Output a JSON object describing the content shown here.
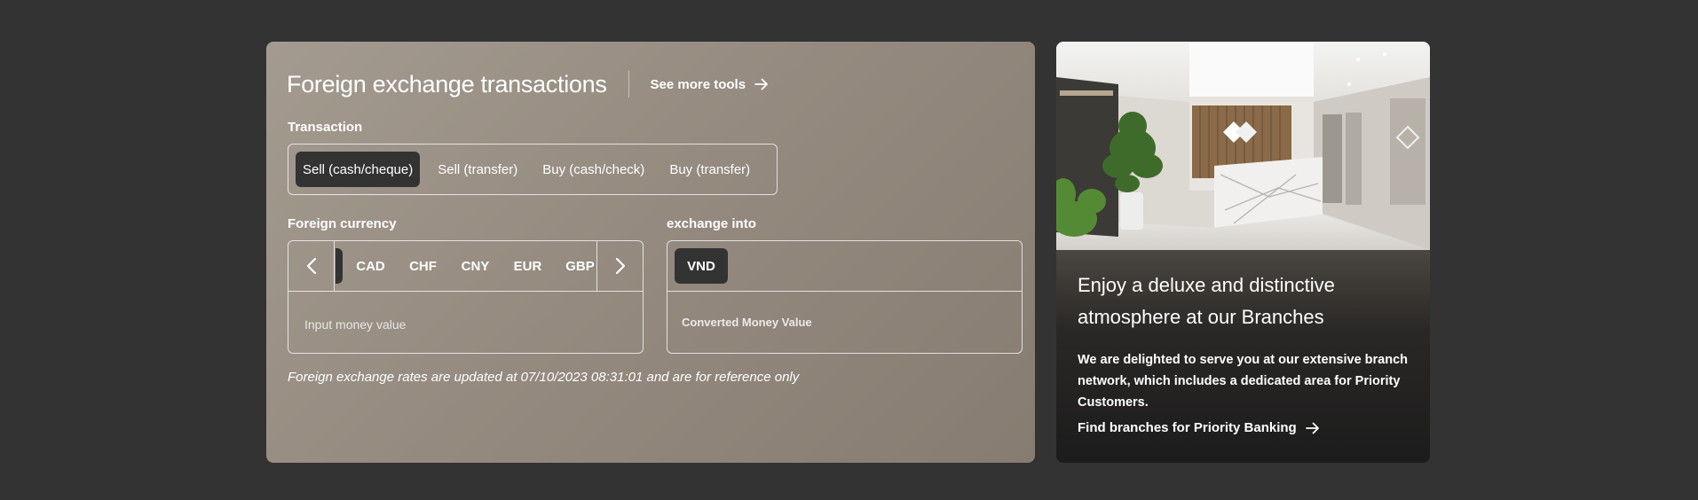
{
  "fx": {
    "title": "Foreign exchange transactions",
    "see_more": "See more tools",
    "transaction_label": "Transaction",
    "transactions": [
      {
        "label": "Sell (cash/cheque)",
        "active": true
      },
      {
        "label": "Sell (transfer)",
        "active": false
      },
      {
        "label": "Buy (cash/check)",
        "active": false
      },
      {
        "label": "Buy (transfer)",
        "active": false
      }
    ],
    "foreign_currency_label": "Foreign currency",
    "currencies": [
      "CAD",
      "CHF",
      "CNY",
      "EUR",
      "GBP"
    ],
    "input_placeholder": "Input money value",
    "exchange_into_label": "exchange into",
    "target_currency": "VND",
    "converted_placeholder": "Converted Money Value",
    "rate_note": "Foreign exchange rates are updated at 07/10/2023 08:31:01 and are for reference only"
  },
  "branch": {
    "title": "Enjoy a deluxe and distinctive atmosphere at our Branches",
    "description": "We are delighted to serve you at our extensive branch network, which includes a dedicated area for Priority Customers.",
    "link": "Find branches for Priority Banking"
  },
  "colors": {
    "page_bg": "#333333",
    "fx_card_bg": "#9a9086",
    "active_pill": "#333333",
    "branch_card_bg": "#1e1e1e"
  }
}
